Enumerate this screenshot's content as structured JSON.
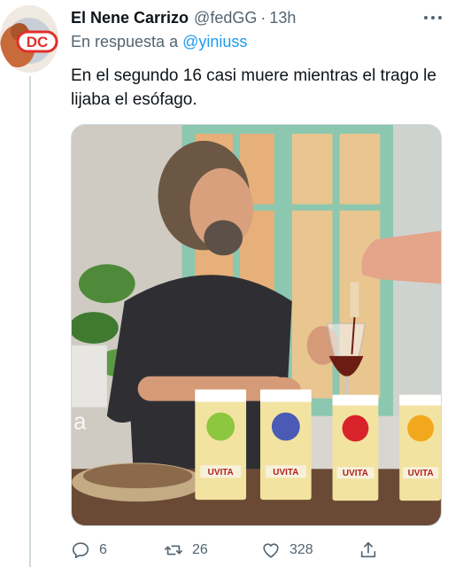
{
  "tweet": {
    "display_name": "El Nene Carrizo",
    "handle": "@fedGG",
    "separator": "·",
    "time": "13h",
    "reply_prefix": "En respuesta a",
    "reply_mention": "@yiniuss",
    "text": "En el segundo 16 casi muere mientras el trago le lijaba el esófago.",
    "avatar_text": "DC",
    "media": {
      "box_label": "UVITA",
      "watermark": "a",
      "grape_colors": [
        "#8dc63f",
        "#4b5bb5",
        "#d8232a",
        "#f2a81d"
      ]
    },
    "actions": {
      "reply_count": "6",
      "retweet_count": "26",
      "like_count": "328"
    }
  },
  "icons": [
    "more-icon",
    "reply-icon",
    "retweet-icon",
    "like-icon",
    "share-icon"
  ],
  "colors": {
    "link": "#1d9bf0",
    "secondary": "#536471",
    "primary": "#0f1419"
  }
}
